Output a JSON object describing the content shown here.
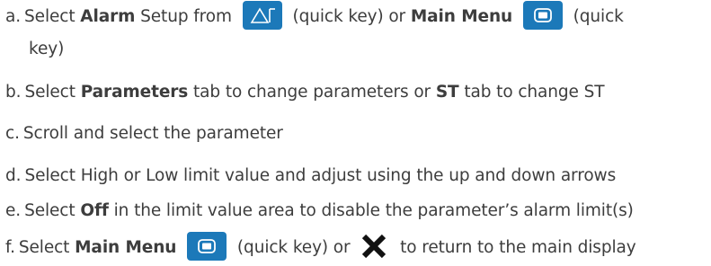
{
  "steps": [
    {
      "marker": "a.",
      "t1": "Select ",
      "b1": "Alarm",
      "t2": " Setup from",
      "t3": " (quick key) or ",
      "b2": "Main Menu",
      "t4": " (quick"
    },
    {
      "t1": "key)"
    },
    {
      "marker": "b.",
      "t1": "Select ",
      "b1": "Parameters",
      "t2": " tab to change parameters or ",
      "b2": "ST",
      "t3": " tab to change ST"
    },
    {
      "marker": "c.",
      "t1": "Scroll and select the parameter"
    },
    {
      "marker": "d.",
      "t1": "Select High or Low limit value and adjust using the up and down arrows"
    },
    {
      "marker": "e.",
      "t1": "Select ",
      "b1": "Off",
      "t2": " in the limit value area to disable the parameter’s alarm limit(s)"
    },
    {
      "marker": "f.",
      "t1": "Select ",
      "b1": "Main Menu",
      "t2": " (quick key) or ",
      "t3": " to return to the main display"
    }
  ],
  "icons": {
    "alarm_setup_key": "alarm-setup-icon",
    "main_menu_key": "main-menu-icon",
    "close": "close-icon"
  },
  "colors": {
    "text": "#3d3d3d",
    "key_background": "#1c79b9",
    "key_glyph": "#ffffff",
    "close_glyph": "#111111"
  }
}
